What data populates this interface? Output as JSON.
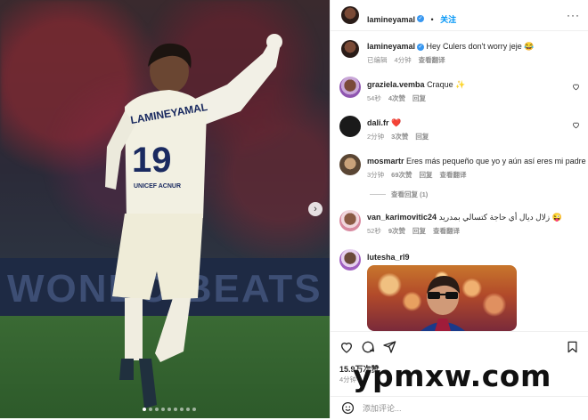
{
  "media": {
    "banner_text": "WONDO BEATS",
    "jersey_name": "LAMINEYAMAL",
    "jersey_number": "19",
    "sponsor": "UNICEF ACNUR",
    "slide_count": 9,
    "active_slide": 0
  },
  "post": {
    "author": "lamineyamal",
    "follow_label": "关注",
    "caption": "Hey Culers don't worry jeje 😂",
    "caption_edited": "已编辑",
    "caption_time": "4分钟",
    "caption_translate": "查看翻译"
  },
  "comments": [
    {
      "username": "graziela.vemba",
      "text": "Craque ✨",
      "time": "54秒",
      "likes": "4次赞",
      "reply": "回复",
      "translate": ""
    },
    {
      "username": "dali.fr",
      "text": "❤️",
      "time": "2分钟",
      "likes": "3次赞",
      "reply": "回复",
      "translate": ""
    },
    {
      "username": "mosmartr",
      "text": "Eres más pequeño que yo y aún así eres mi padre",
      "time": "3分钟",
      "likes": "69次赞",
      "reply": "回复",
      "translate": "查看翻译",
      "view_replies": "查看回复 (1)"
    },
    {
      "username": "van_karimovitic24",
      "text": "زلال ديال أي حاجة كتسالي بمدريد 😜",
      "time": "52秒",
      "likes": "9次赞",
      "reply": "回复",
      "translate": "查看翻译"
    },
    {
      "username": "lutesha_rl9",
      "text": "",
      "time": "",
      "likes": "",
      "reply": "",
      "translate": ""
    }
  ],
  "footer": {
    "likes_count": "15.9万次赞",
    "time_ago": "4分钟",
    "add_comment_placeholder": "添加评论..."
  },
  "watermark": "ypmxw.com",
  "colors": {
    "accent": "#0095f6",
    "heart": "#ed4956",
    "verified": "#3897f0"
  }
}
